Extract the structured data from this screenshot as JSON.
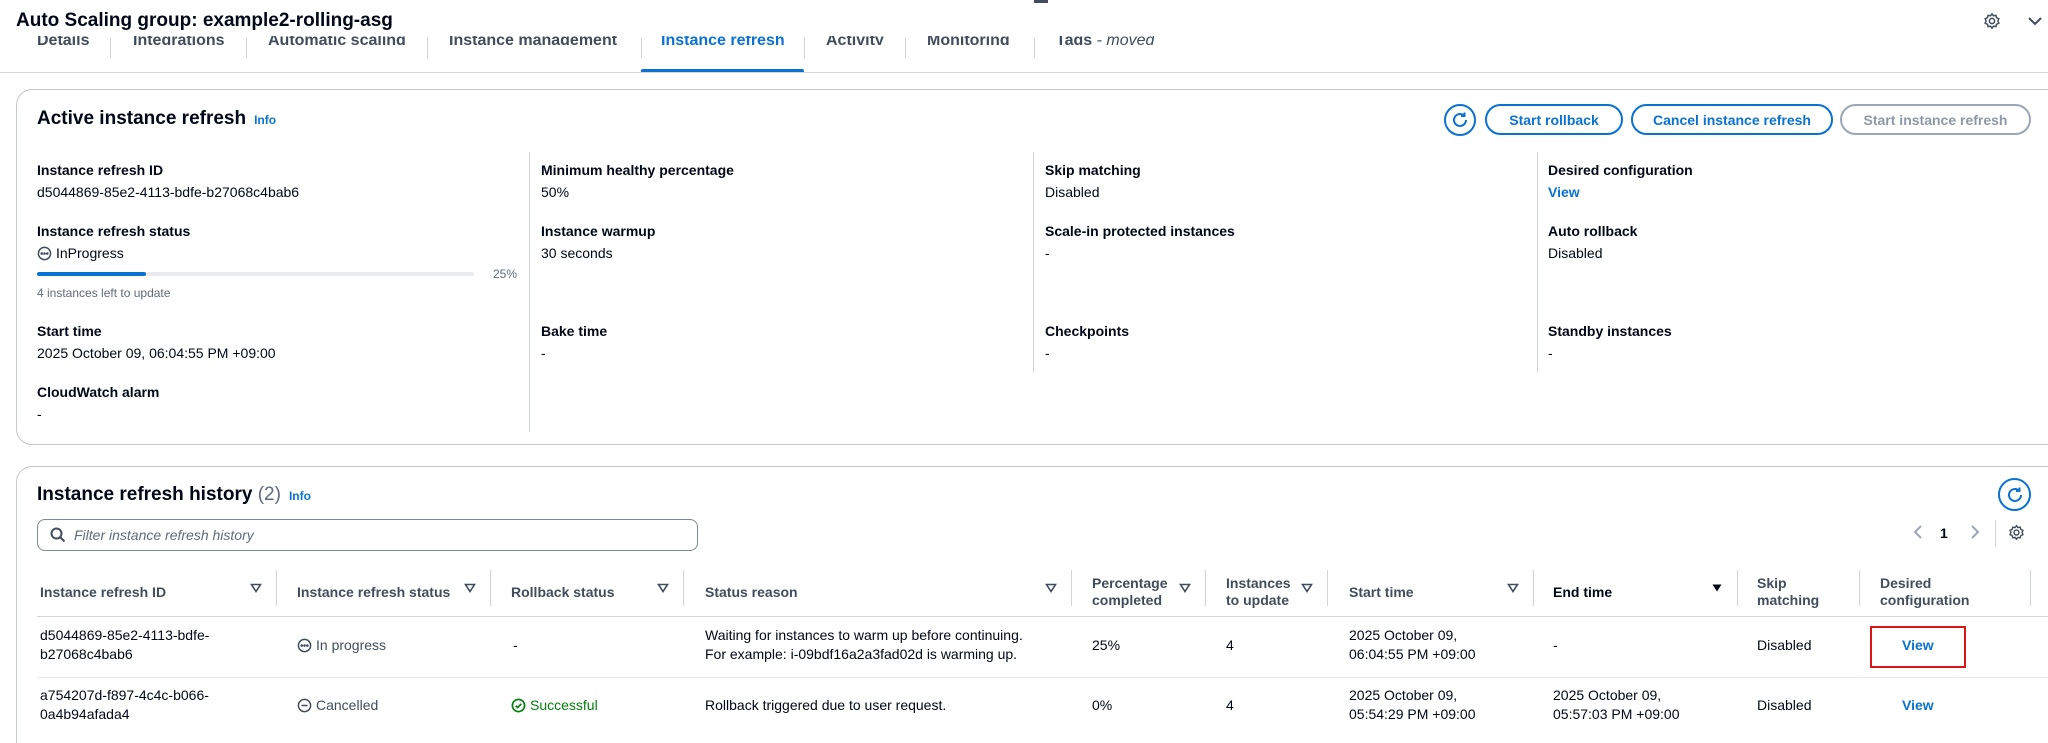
{
  "header": {
    "title": "Auto Scaling group: example2-rolling-asg"
  },
  "tabs": [
    {
      "label": "Details"
    },
    {
      "label": "Integrations"
    },
    {
      "label": "Automatic scaling"
    },
    {
      "label": "Instance management"
    },
    {
      "label": "Instance refresh",
      "active": true
    },
    {
      "label": "Activity"
    },
    {
      "label": "Monitoring"
    },
    {
      "label": "Tags",
      "suffix": "- moved"
    }
  ],
  "active_refresh": {
    "title": "Active instance refresh",
    "info": "Info",
    "buttons": {
      "start_rollback": "Start rollback",
      "cancel_refresh": "Cancel instance refresh",
      "start_refresh": "Start instance refresh"
    },
    "fields": {
      "refresh_id_label": "Instance refresh ID",
      "refresh_id": "d5044869-85e2-4113-bdfe-b27068c4bab6",
      "status_label": "Instance refresh status",
      "status": "InProgress",
      "progress_percent": 25,
      "progress_text": "25%",
      "progress_desc": "4 instances left to update",
      "start_time_label": "Start time",
      "start_time": "2025 October 09, 06:04:55 PM +09:00",
      "cloudwatch_label": "CloudWatch alarm",
      "cloudwatch": "-",
      "min_healthy_label": "Minimum healthy percentage",
      "min_healthy": "50%",
      "warmup_label": "Instance warmup",
      "warmup": "30 seconds",
      "bake_label": "Bake time",
      "bake": "-",
      "skip_matching_label": "Skip matching",
      "skip_matching": "Disabled",
      "scale_in_label": "Scale-in protected instances",
      "scale_in": "-",
      "checkpoints_label": "Checkpoints",
      "checkpoints": "-",
      "desired_config_label": "Desired configuration",
      "desired_config": "View",
      "auto_rollback_label": "Auto rollback",
      "auto_rollback": "Disabled",
      "standby_label": "Standby instances",
      "standby": "-"
    }
  },
  "history": {
    "title": "Instance refresh history",
    "count": "(2)",
    "info": "Info",
    "filter_placeholder": "Filter instance refresh history",
    "page": "1",
    "columns": {
      "id": "Instance refresh ID",
      "status": "Instance refresh status",
      "rollback": "Rollback status",
      "reason": "Status reason",
      "pct_1": "Percentage",
      "pct_2": "completed",
      "inst_1": "Instances",
      "inst_2": "to update",
      "start": "Start time",
      "end": "End time",
      "skip_1": "Skip",
      "skip_2": "matching",
      "desired_1": "Desired",
      "desired_2": "configuration"
    },
    "rows": [
      {
        "id_1": "d5044869-85e2-4113-bdfe-",
        "id_2": "b27068c4bab6",
        "status": "In progress",
        "rollback": "-",
        "reason_1": "Waiting for instances to warm up before continuing.",
        "reason_2": "For example: i-09bdf16a2a3fad02d is warming up.",
        "pct": "25%",
        "instances": "4",
        "start_1": "2025 October 09,",
        "start_2": "06:04:55 PM +09:00",
        "end_1": "-",
        "end_2": "",
        "skip": "Disabled",
        "desired": "View"
      },
      {
        "id_1": "a754207d-f897-4c4c-b066-",
        "id_2": "0a4b94afada4",
        "status": "Cancelled",
        "rollback": "Successful",
        "reason_1": "Rollback triggered due to user request.",
        "reason_2": "",
        "pct": "0%",
        "instances": "4",
        "start_1": "2025 October 09,",
        "start_2": "05:54:29 PM +09:00",
        "end_1": "2025 October 09,",
        "end_2": "05:57:03 PM +09:00",
        "skip": "Disabled",
        "desired": "View"
      }
    ]
  },
  "colors": {
    "link": "#0972d3",
    "success": "#037f0c",
    "highlight": "#d91515"
  },
  "icons": [
    "gear-icon",
    "chevron-down-icon",
    "refresh-icon",
    "search-icon",
    "chevron-left-icon",
    "chevron-right-icon",
    "sort-icon",
    "in-progress-icon",
    "stopped-icon",
    "success-icon"
  ]
}
